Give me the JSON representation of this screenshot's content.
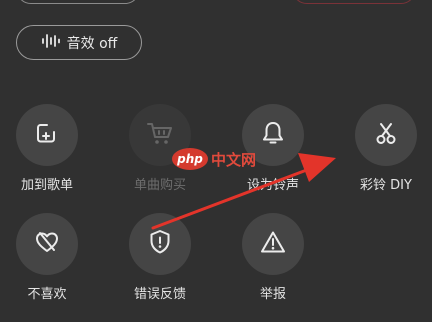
{
  "sound_effect": {
    "label": "音效 off",
    "icon": "waveform-icon"
  },
  "actions": [
    {
      "label": "加到歌单",
      "icon": "add-to-playlist-icon",
      "enabled": true
    },
    {
      "label": "单曲购买",
      "icon": "shopping-cart-icon",
      "enabled": false
    },
    {
      "label": "设为铃声",
      "icon": "bell-icon",
      "enabled": true
    },
    {
      "label": "彩铃 DIY",
      "icon": "scissors-icon",
      "enabled": true
    },
    {
      "label": "不喜欢",
      "icon": "dislike-heart-icon",
      "enabled": true
    },
    {
      "label": "错误反馈",
      "icon": "shield-alert-icon",
      "enabled": true
    },
    {
      "label": "举报",
      "icon": "warning-triangle-icon",
      "enabled": true
    }
  ],
  "watermark": {
    "logo_text": "php",
    "site_text": "中文网"
  },
  "colors": {
    "background": "#303030",
    "circle": "#454545",
    "arrow": "#e3342a"
  }
}
